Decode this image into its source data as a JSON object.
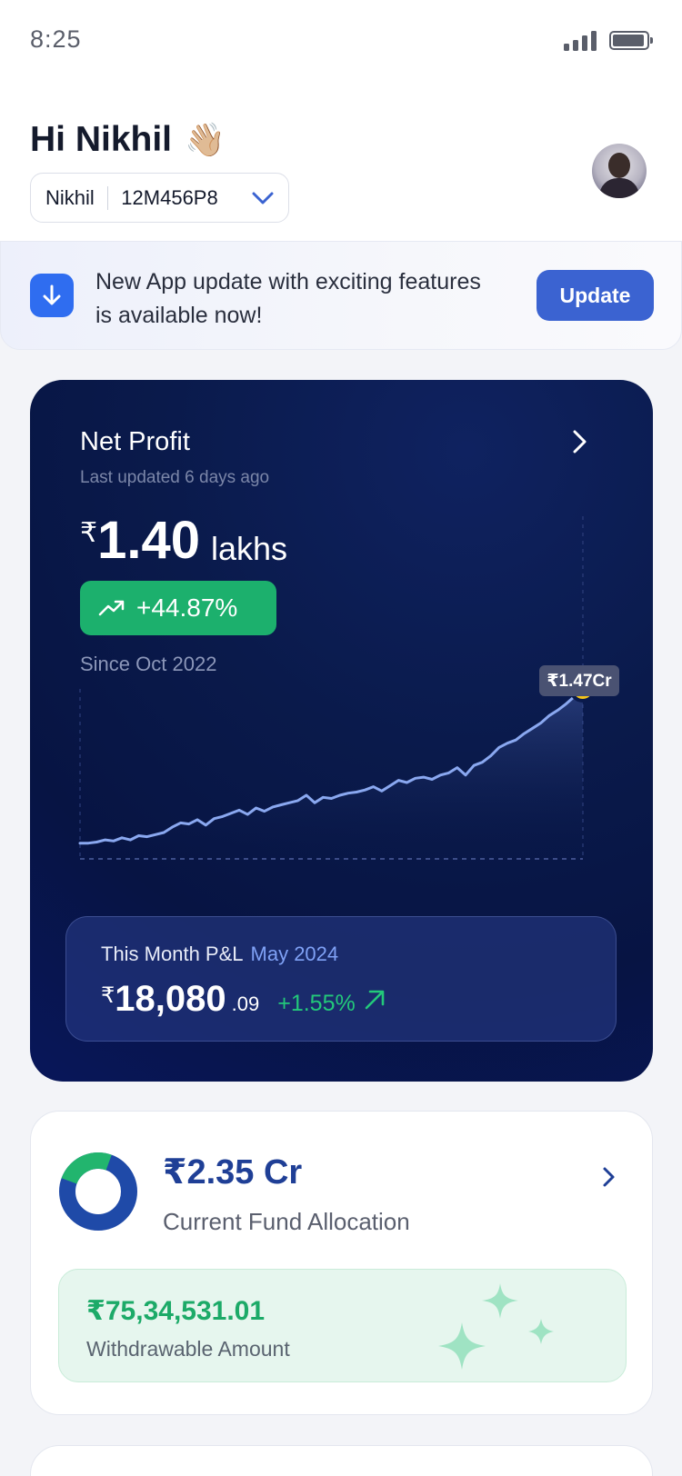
{
  "status_bar": {
    "time": "8:25"
  },
  "header": {
    "greeting": "Hi Nikhil",
    "wave_emoji": "👋🏼",
    "account": {
      "name": "Nikhil",
      "id": "12M456P8"
    }
  },
  "update_banner": {
    "message": "New App update with exciting features is available now!",
    "button_label": "Update"
  },
  "net_profit": {
    "title": "Net Profit",
    "last_updated": "Last updated 6 days ago",
    "currency_symbol": "₹",
    "value": "1.40",
    "unit": "lakhs",
    "change": "+44.87%",
    "since": "Since Oct 2022",
    "tooltip": "₹1.47Cr",
    "line_color": "#8aa8f0",
    "marker_color": "#f5c518",
    "badge_color": "#1cb06d"
  },
  "month_pl": {
    "label": "This Month P&L",
    "month": "May 2024",
    "currency_symbol": "₹",
    "value": "18,080",
    "decimal": ".09",
    "change": "+1.55%"
  },
  "fund_allocation": {
    "value": "₹2.35 Cr",
    "label": "Current Fund Allocation",
    "withdrawable_value": "₹75,34,531.01",
    "withdrawable_label": "Withdrawable Amount",
    "donut_fraction_green": 0.25
  },
  "colors": {
    "accent_blue": "#3b63d1",
    "card_navy": "#0a1a4b",
    "positive_green": "#1cb06d"
  },
  "chart_data": {
    "type": "line",
    "title": "Net Profit",
    "xlabel": "",
    "ylabel": "",
    "grid": false,
    "series": [
      {
        "values": [
          0.02,
          0.02,
          0.03,
          0.05,
          0.04,
          0.07,
          0.05,
          0.09,
          0.08,
          0.1,
          0.12,
          0.17,
          0.21,
          0.2,
          0.24,
          0.19,
          0.25,
          0.27,
          0.3,
          0.33,
          0.29,
          0.35,
          0.32,
          0.36,
          0.38,
          0.4,
          0.42,
          0.47,
          0.4,
          0.45,
          0.44,
          0.47,
          0.49,
          0.5,
          0.52,
          0.55,
          0.51,
          0.56,
          0.61,
          0.59,
          0.63,
          0.64,
          0.62,
          0.66,
          0.68,
          0.73,
          0.66,
          0.75,
          0.78,
          0.84,
          0.92,
          0.96,
          0.99,
          1.05,
          1.1,
          1.15,
          1.22,
          1.27,
          1.33,
          1.4,
          1.47
        ]
      }
    ]
  }
}
